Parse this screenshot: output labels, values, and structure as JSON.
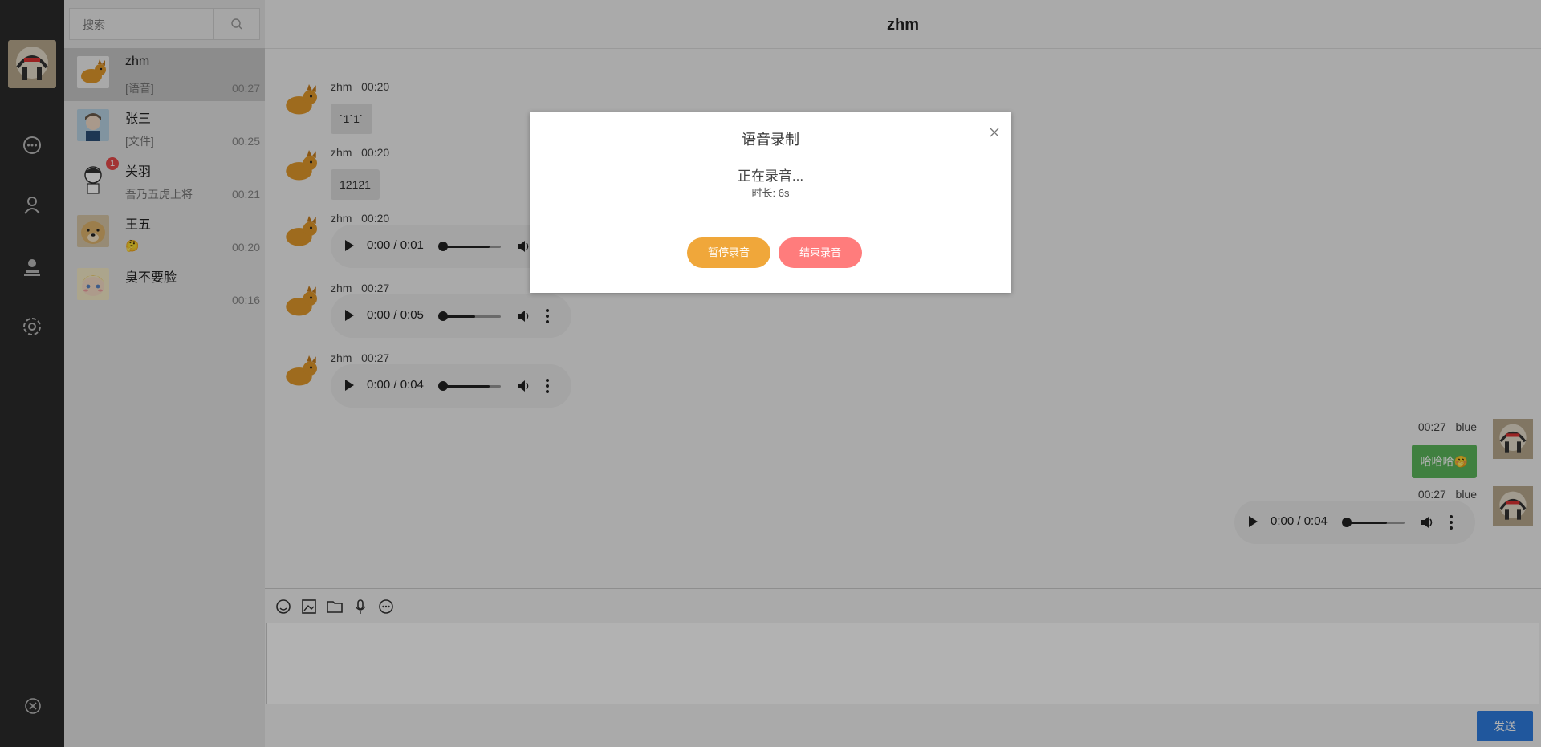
{
  "user": {
    "name": "blue"
  },
  "search": {
    "placeholder": "搜索"
  },
  "sessions": [
    {
      "name": "zhm",
      "preview": "[语音]",
      "time": "00:27",
      "active": true
    },
    {
      "name": "张三",
      "preview": "[文件]",
      "time": "00:25"
    },
    {
      "name": "关羽",
      "preview": "吾乃五虎上将",
      "time": "00:21",
      "badge": "1"
    },
    {
      "name": "王五",
      "preview": "🤔",
      "time": "00:20"
    },
    {
      "name": "臭不要脸",
      "preview": "",
      "time": "00:16"
    }
  ],
  "chat": {
    "title": "zhm",
    "messages": [
      {
        "sender": "zhm",
        "time": "00:20",
        "text": "`1`1`"
      },
      {
        "sender": "zhm",
        "time": "00:20",
        "text": "12121"
      },
      {
        "sender": "zhm",
        "time": "00:20",
        "audio_time": "0:00 / 0:01",
        "progress": 0.8
      },
      {
        "sender": "zhm",
        "time": "00:27",
        "audio_time": "0:00 / 0:05",
        "progress": 0.55
      },
      {
        "sender": "zhm",
        "time": "00:27",
        "audio_time": "0:00 / 0:04",
        "progress": 0.8
      },
      {
        "sender": "blue",
        "time": "00:27",
        "text": "哈哈哈🤭"
      },
      {
        "sender": "blue",
        "time": "00:27",
        "audio_time": "0:00 / 0:04",
        "progress": 0.7
      }
    ]
  },
  "toolbar": {
    "icons": [
      "emoji-icon",
      "image-icon",
      "folder-icon",
      "mic-icon",
      "chat-icon"
    ]
  },
  "send_label": "发送",
  "modal": {
    "title": "语音录制",
    "status": "正在录音...",
    "duration": "时长: 6s",
    "pause_label": "暂停录音",
    "stop_label": "结束录音"
  },
  "colors": {
    "nav": "#2b2b2b",
    "pause": "#f0a73a",
    "stop": "#ff7c7c",
    "send": "#2f7de1",
    "mine_bubble": "#5cb85c"
  }
}
